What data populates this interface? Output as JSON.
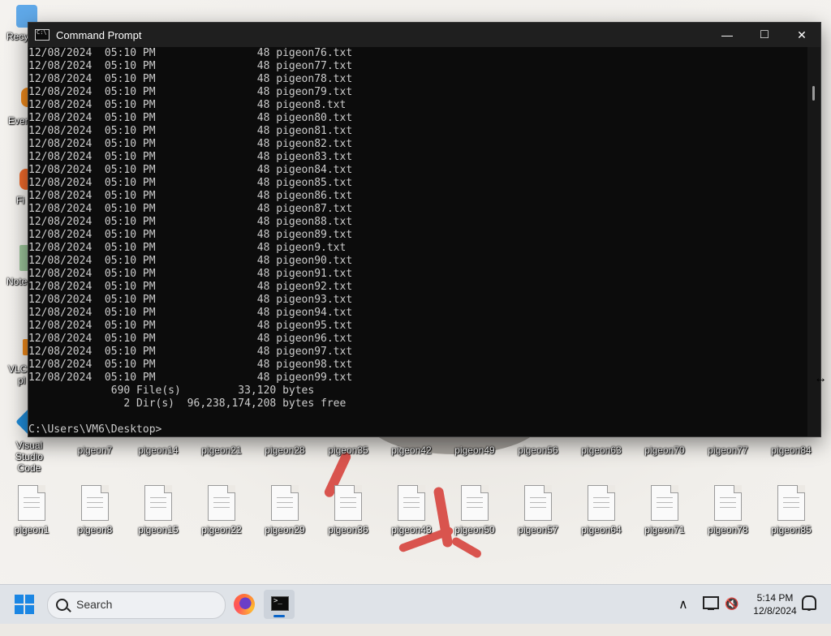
{
  "window": {
    "title": "Command Prompt",
    "minimize_label": "—",
    "maximize_label": "□",
    "close_label": "✕"
  },
  "console": {
    "lines": [
      "12/08/2024  05:10 PM                48 pigeon76.txt",
      "12/08/2024  05:10 PM                48 pigeon77.txt",
      "12/08/2024  05:10 PM                48 pigeon78.txt",
      "12/08/2024  05:10 PM                48 pigeon79.txt",
      "12/08/2024  05:10 PM                48 pigeon8.txt",
      "12/08/2024  05:10 PM                48 pigeon80.txt",
      "12/08/2024  05:10 PM                48 pigeon81.txt",
      "12/08/2024  05:10 PM                48 pigeon82.txt",
      "12/08/2024  05:10 PM                48 pigeon83.txt",
      "12/08/2024  05:10 PM                48 pigeon84.txt",
      "12/08/2024  05:10 PM                48 pigeon85.txt",
      "12/08/2024  05:10 PM                48 pigeon86.txt",
      "12/08/2024  05:10 PM                48 pigeon87.txt",
      "12/08/2024  05:10 PM                48 pigeon88.txt",
      "12/08/2024  05:10 PM                48 pigeon89.txt",
      "12/08/2024  05:10 PM                48 pigeon9.txt",
      "12/08/2024  05:10 PM                48 pigeon90.txt",
      "12/08/2024  05:10 PM                48 pigeon91.txt",
      "12/08/2024  05:10 PM                48 pigeon92.txt",
      "12/08/2024  05:10 PM                48 pigeon93.txt",
      "12/08/2024  05:10 PM                48 pigeon94.txt",
      "12/08/2024  05:10 PM                48 pigeon95.txt",
      "12/08/2024  05:10 PM                48 pigeon96.txt",
      "12/08/2024  05:10 PM                48 pigeon97.txt",
      "12/08/2024  05:10 PM                48 pigeon98.txt",
      "12/08/2024  05:10 PM                48 pigeon99.txt",
      "             690 File(s)         33,120 bytes",
      "               2 Dir(s)  96,238,174,208 bytes free",
      "",
      "C:\\Users\\VM6\\Desktop>"
    ]
  },
  "desktop": {
    "row1_left_icons": [
      "Visual Studio Code"
    ],
    "row1_files": [
      "pigeon7",
      "pigeon14",
      "pigeon21",
      "pigeon28",
      "pigeon35",
      "pigeon42",
      "pigeon49",
      "pigeon56",
      "pigeon63",
      "pigeon70",
      "pigeon77",
      "pigeon84"
    ],
    "row2_files": [
      "pigeon1",
      "pigeon8",
      "pigeon15",
      "pigeon22",
      "pigeon29",
      "pigeon36",
      "pigeon43",
      "pigeon50",
      "pigeon57",
      "pigeon64",
      "pigeon71",
      "pigeon78",
      "pigeon85"
    ],
    "partial_left_labels": [
      "Recy",
      "Ever",
      "Fi",
      "Note",
      "VLC",
      "pl"
    ]
  },
  "taskbar": {
    "search_placeholder": "Search",
    "time": "5:14 PM",
    "date": "12/8/2024",
    "tray_chevron": "∧",
    "volume_icon_glyph": "🔇"
  },
  "colors": {
    "console_bg": "#0c0c0c",
    "console_text": "#cccccc",
    "titlebar_bg": "#1f1f1f",
    "accent": "#0a64c8"
  }
}
